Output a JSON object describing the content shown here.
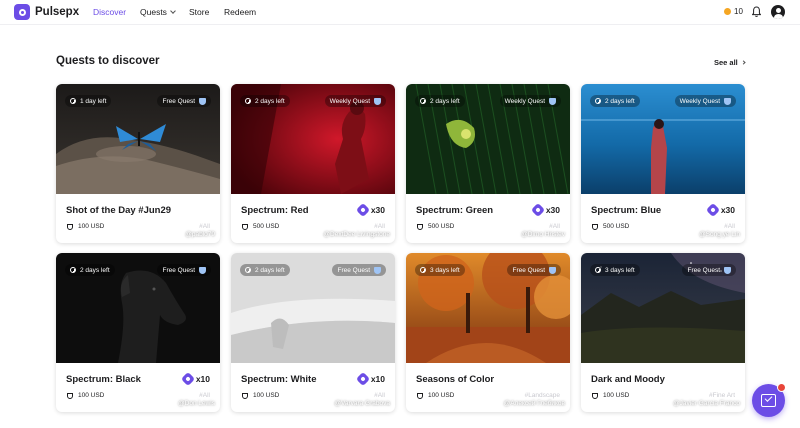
{
  "app": {
    "name": "Pulsepx"
  },
  "nav": {
    "items": [
      {
        "label": "Discover",
        "active": true
      },
      {
        "label": "Quests",
        "dropdown": true
      },
      {
        "label": "Store"
      },
      {
        "label": "Redeem"
      }
    ],
    "coins": "10",
    "icons": [
      "coin-icon",
      "bell-icon",
      "avatar"
    ]
  },
  "section": {
    "title": "Quests to discover",
    "see_all": "See all"
  },
  "colors": {
    "accent": "#6c4de6",
    "notification": "#e8463a",
    "coin": "#f5a623"
  },
  "quests": [
    {
      "time_left": "1 day left",
      "type": "Free Quest",
      "credit": "@pablo79",
      "title": "Shot of the Day #Jun29",
      "reward": "",
      "prize": "100 USD",
      "tag": "#All"
    },
    {
      "time_left": "2 days left",
      "type": "Weekly Quest",
      "credit": "@DextDee Livingstone",
      "title": "Spectrum: Red",
      "reward": "x30",
      "prize": "500 USD",
      "tag": "#All"
    },
    {
      "time_left": "2 days left",
      "type": "Weekly Quest",
      "credit": "@Dimo Hristev",
      "title": "Spectrum: Green",
      "reward": "x30",
      "prize": "500 USD",
      "tag": "#All"
    },
    {
      "time_left": "2 days left",
      "type": "Weekly Quest",
      "credit": "@Song ye Lin",
      "title": "Spectrum: Blue",
      "reward": "x30",
      "prize": "500 USD",
      "tag": "#All"
    },
    {
      "time_left": "2 days left",
      "type": "Free Quest",
      "credit": "@Don Lewis",
      "title": "Spectrum: Black",
      "reward": "x10",
      "prize": "100 USD",
      "tag": "#All"
    },
    {
      "time_left": "2 days left",
      "type": "Free Quest",
      "credit": "@Varvara Grabova",
      "title": "Spectrum: White",
      "reward": "x10",
      "prize": "100 USD",
      "tag": "#All"
    },
    {
      "time_left": "3 days left",
      "type": "Free Quest",
      "credit": "@Алексей Глебиков",
      "title": "Seasons of Color",
      "reward": "",
      "prize": "100 USD",
      "tag": "#Landscape"
    },
    {
      "time_left": "3 days left",
      "type": "Free Quest",
      "credit": "@Javier Garcia Franco",
      "title": "Dark and Moody",
      "reward": "",
      "prize": "100 USD",
      "tag": "#Fine Art"
    }
  ]
}
